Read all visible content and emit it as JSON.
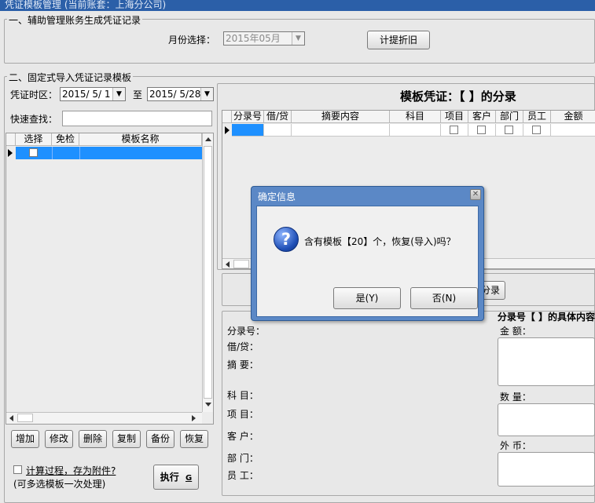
{
  "window": {
    "title": "凭证模板管理 (当前账套：上海分公司)"
  },
  "section1": {
    "title": "一、辅助管理账务生成凭证记录",
    "month_label": "月份选择：",
    "month_value": "2015年05月",
    "depreciation_button": "计提折旧"
  },
  "section2": {
    "title": "二、固定式导入凭证记录模板",
    "period_label": "凭证时区：",
    "date_from": "2015/ 5/ 1",
    "to_label": "至",
    "date_to": "2015/ 5/28",
    "quick_find_label": "快速查找：",
    "list_headers": [
      "选择",
      "免检",
      "模板名称"
    ],
    "buttons": [
      "增加",
      "修改",
      "删除",
      "复制",
      "备份",
      "恢复"
    ],
    "calc_checkbox_label": "计算过程，存为附件?",
    "multi_select_note": "(可多选模板一次处理)",
    "execute_button": "执行",
    "execute_hotkey": "G"
  },
  "template_entries": {
    "heading": "模板凭证：【 】的分录",
    "headers": [
      "分录号",
      "借/贷",
      "摘要内容",
      "科目",
      "项目",
      "客户",
      "部门",
      "员工",
      "金额"
    ],
    "entry_button_fragment": "分录"
  },
  "detail": {
    "heading_fragment": "分录号【 】的具体内容",
    "fields_left": [
      "分录号：",
      "借/贷：",
      "摘  要：",
      "科  目：",
      "项  目：",
      "客  户：",
      "部  门：",
      "员  工："
    ],
    "amount_label": "金  额：",
    "quantity_label": "数  量：",
    "foreign_label": "外  币："
  },
  "dialog": {
    "title": "确定信息",
    "message": "含有模板【20】个，恢复(导入)吗？",
    "yes_button": "是(Y)",
    "no_button": "否(N)",
    "icon": "question-icon"
  }
}
